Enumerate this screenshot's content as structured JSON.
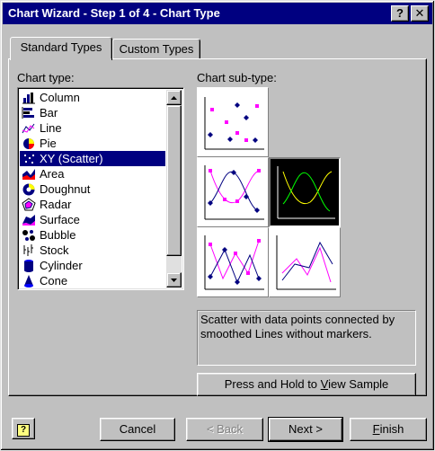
{
  "window": {
    "title": "Chart Wizard - Step 1 of 4 - Chart Type",
    "help_button": "?",
    "close_button": "✕"
  },
  "tabs": [
    {
      "label": "Standard Types",
      "active": true
    },
    {
      "label": "Custom Types",
      "active": false
    }
  ],
  "chart_type": {
    "label": "Chart type:",
    "items": [
      {
        "label": "Column",
        "icon": "column-chart-icon",
        "selected": false
      },
      {
        "label": "Bar",
        "icon": "bar-chart-icon",
        "selected": false
      },
      {
        "label": "Line",
        "icon": "line-chart-icon",
        "selected": false
      },
      {
        "label": "Pie",
        "icon": "pie-chart-icon",
        "selected": false
      },
      {
        "label": "XY (Scatter)",
        "icon": "scatter-chart-icon",
        "selected": true
      },
      {
        "label": "Area",
        "icon": "area-chart-icon",
        "selected": false
      },
      {
        "label": "Doughnut",
        "icon": "doughnut-chart-icon",
        "selected": false
      },
      {
        "label": "Radar",
        "icon": "radar-chart-icon",
        "selected": false
      },
      {
        "label": "Surface",
        "icon": "surface-chart-icon",
        "selected": false
      },
      {
        "label": "Bubble",
        "icon": "bubble-chart-icon",
        "selected": false
      },
      {
        "label": "Stock",
        "icon": "stock-chart-icon",
        "selected": false
      },
      {
        "label": "Cylinder",
        "icon": "cylinder-chart-icon",
        "selected": false
      },
      {
        "label": "Cone",
        "icon": "cone-chart-icon",
        "selected": false
      }
    ]
  },
  "chart_subtype": {
    "label": "Chart sub-type:",
    "selected_index": 2,
    "description": "Scatter with data points connected by smoothed Lines without markers."
  },
  "sample_button": {
    "pre": "Press and Hold to ",
    "accel": "V",
    "post": "iew Sample"
  },
  "footer": {
    "help_icon": "?",
    "cancel": "Cancel",
    "back": "< Back",
    "next": "Next >",
    "finish_accel": "F",
    "finish_rest": "inish"
  },
  "colors": {
    "titlebar": "#000080",
    "face": "#c0c0c0",
    "selection": "#000080",
    "series_magenta": "#ff00ff",
    "series_navy": "#000080",
    "series_yellow": "#ffff00",
    "series_green": "#00ff00"
  }
}
